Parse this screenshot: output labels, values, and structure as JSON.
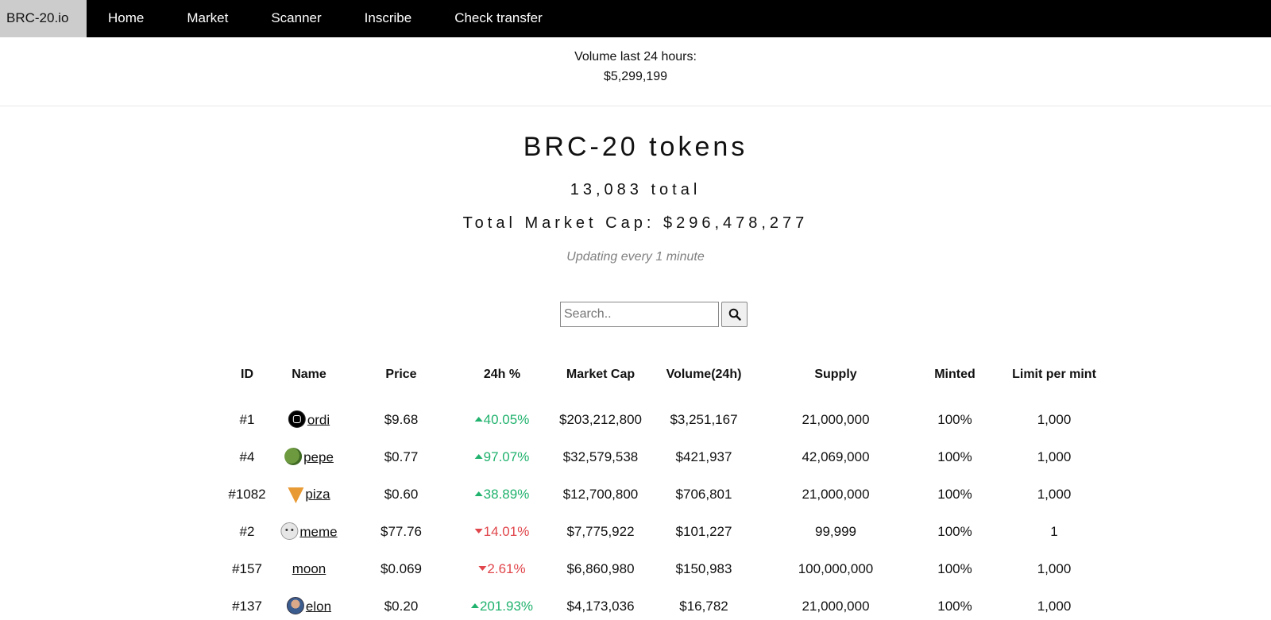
{
  "nav": {
    "brand": "BRC-20.io",
    "items": [
      "Home",
      "Market",
      "Scanner",
      "Inscribe",
      "Check transfer"
    ]
  },
  "volume": {
    "label": "Volume last 24 hours:",
    "value": "$5,299,199"
  },
  "header": {
    "title": "BRC-20 tokens",
    "total": "13,083 total",
    "market_cap": "Total Market Cap: $296,478,277",
    "updating": "Updating every 1 minute"
  },
  "search": {
    "placeholder": "Search.."
  },
  "table": {
    "columns": [
      "ID",
      "Name",
      "Price",
      "24h %",
      "Market Cap",
      "Volume(24h)",
      "Supply",
      "Minted",
      "Limit per mint"
    ],
    "rows": [
      {
        "id": "#1",
        "name": "ordi",
        "icon": "ordi-icon",
        "price": "$9.68",
        "change": "40.05%",
        "dir": "up",
        "mcap": "$203,212,800",
        "vol": "$3,251,167",
        "supply": "21,000,000",
        "minted": "100%",
        "limit": "1,000"
      },
      {
        "id": "#4",
        "name": "pepe",
        "icon": "pepe-icon",
        "price": "$0.77",
        "change": "97.07%",
        "dir": "up",
        "mcap": "$32,579,538",
        "vol": "$421,937",
        "supply": "42,069,000",
        "minted": "100%",
        "limit": "1,000"
      },
      {
        "id": "#1082",
        "name": "piza",
        "icon": "pizza-icon",
        "price": "$0.60",
        "change": "38.89%",
        "dir": "up",
        "mcap": "$12,700,800",
        "vol": "$706,801",
        "supply": "21,000,000",
        "minted": "100%",
        "limit": "1,000"
      },
      {
        "id": "#2",
        "name": "meme",
        "icon": "meme-icon",
        "price": "$77.76",
        "change": "14.01%",
        "dir": "down",
        "mcap": "$7,775,922",
        "vol": "$101,227",
        "supply": "99,999",
        "minted": "100%",
        "limit": "1"
      },
      {
        "id": "#157",
        "name": "moon",
        "icon": "",
        "price": "$0.069",
        "change": "2.61%",
        "dir": "down",
        "mcap": "$6,860,980",
        "vol": "$150,983",
        "supply": "100,000,000",
        "minted": "100%",
        "limit": "1,000"
      },
      {
        "id": "#137",
        "name": "elon",
        "icon": "elon-icon",
        "price": "$0.20",
        "change": "201.93%",
        "dir": "up",
        "mcap": "$4,173,036",
        "vol": "$16,782",
        "supply": "21,000,000",
        "minted": "100%",
        "limit": "1,000"
      }
    ]
  },
  "colors": {
    "up": "#21b26e",
    "down": "#e0464b",
    "nav_bg": "#000000",
    "brand_bg": "#cccccc"
  }
}
